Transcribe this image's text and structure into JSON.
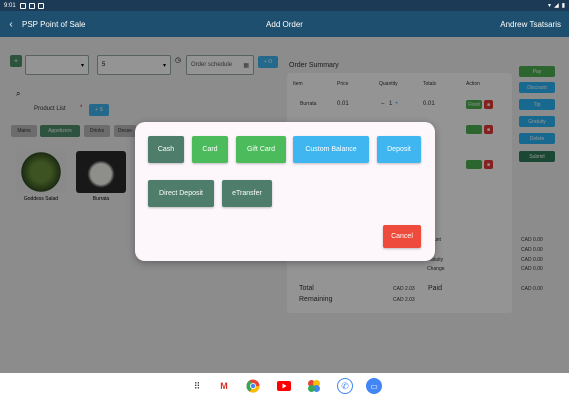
{
  "status": {
    "time": "9:01"
  },
  "appbar": {
    "back_icon": "arrow-left-icon",
    "title": "PSP Point of Sale",
    "center": "Add Order",
    "user": "Andrew Tsatsaris"
  },
  "left": {
    "customer_value": "",
    "table_value": "5",
    "order_scheduled_placeholder": "Order schedule",
    "add_order_label": "+ O",
    "product_list_label": "Product List",
    "product_list_star": "*",
    "add_product_label": "+ S",
    "categories": [
      "Mains",
      "Appetizers",
      "Drinks",
      "Desse"
    ],
    "products": [
      {
        "name": "Goddess Salad"
      },
      {
        "name": "Burrata"
      }
    ]
  },
  "order": {
    "title": "Order Summary",
    "headers": [
      "Item",
      "Price",
      "Quantity",
      "Totals",
      "Action"
    ],
    "row": {
      "item": "Burrata",
      "price": "0.01",
      "qty_minus": "–",
      "qty": "1",
      "qty_plus": "+",
      "total": "0.01",
      "action": "Fired"
    }
  },
  "side_buttons": [
    {
      "label": "Pay",
      "color": "#4caf50"
    },
    {
      "label": "Discount",
      "color": "#29b6f6"
    },
    {
      "label": "Tip",
      "color": "#29b6f6"
    },
    {
      "label": "Gratuity",
      "color": "#29b6f6"
    },
    {
      "label": "Delete",
      "color": "#29b6f6"
    },
    {
      "label": "Submit",
      "color": "#2e7d5b"
    }
  ],
  "totals": {
    "rows": [
      {
        "label": "...ount",
        "value": "CAD 0.00"
      },
      {
        "label": "",
        "value": "CAD 0.00"
      },
      {
        "label": "...atuity",
        "value": "CAD 0.00"
      },
      {
        "label": "Change",
        "value": "CAD 0.00"
      }
    ],
    "total_label": "Total",
    "total_value": "CAD 2.03",
    "paid_label": "Paid",
    "paid_value": "CAD 0.00",
    "remaining_label": "Remaining",
    "remaining_value": "CAD 2.03"
  },
  "modal": {
    "buttons": [
      {
        "label": "Cash",
        "color": "#4e7d6c"
      },
      {
        "label": "Card",
        "color": "#4cbb5c"
      },
      {
        "label": "Gift Card",
        "color": "#4cbb5c"
      },
      {
        "label": "Custom Balance",
        "color": "#3fb6f0"
      },
      {
        "label": "Deposit",
        "color": "#3fb6f0"
      },
      {
        "label": "Direct Deposit",
        "color": "#4e7d6c"
      },
      {
        "label": "eTransfer",
        "color": "#4e7d6c"
      }
    ],
    "cancel": {
      "label": "Cancel",
      "color": "#ef4b3c"
    }
  },
  "navbar": {
    "icons": [
      "apps-icon",
      "gmail-icon",
      "chrome-icon",
      "youtube-icon",
      "photos-icon",
      "phone-icon",
      "messages-icon"
    ]
  }
}
